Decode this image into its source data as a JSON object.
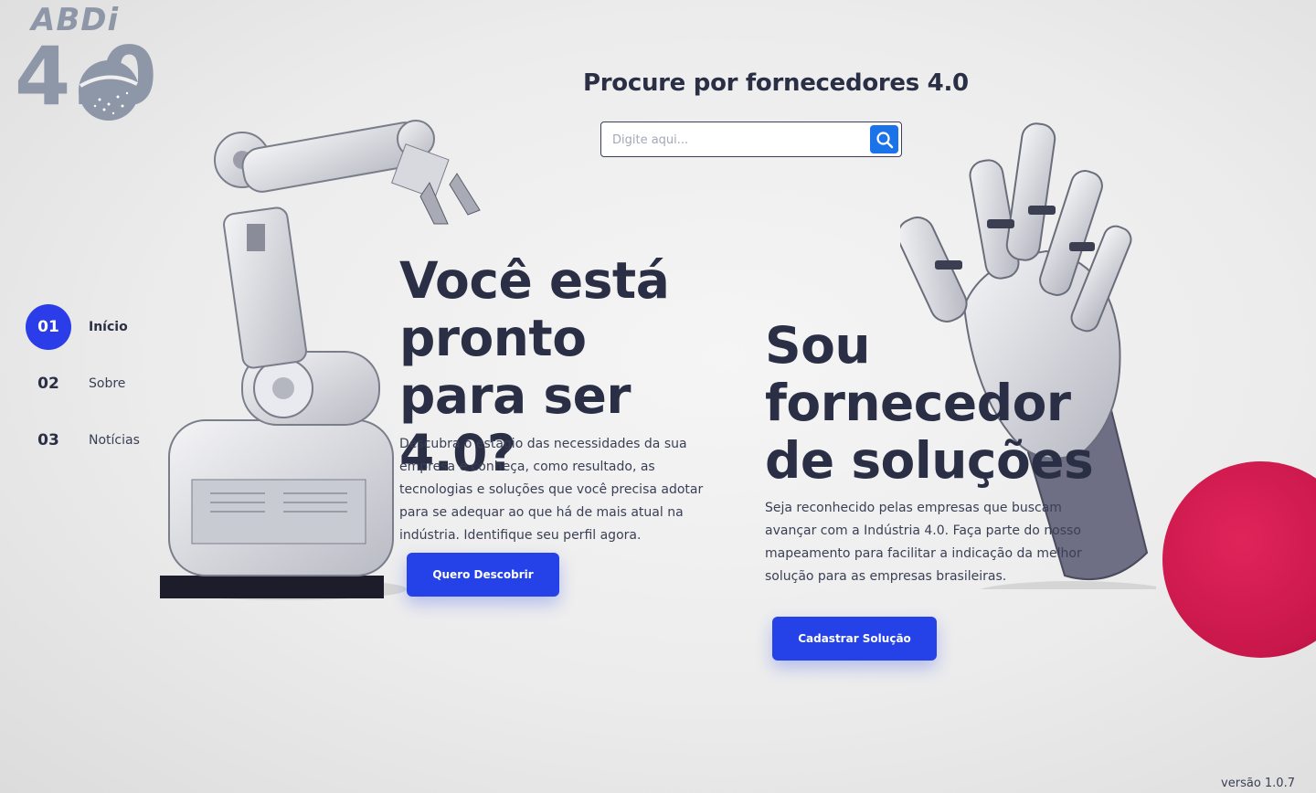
{
  "logo": {
    "brand": "ABDi",
    "sub": "4.0"
  },
  "search": {
    "title": "Procure por fornecedores 4.0",
    "placeholder": "Digite aqui...",
    "value": "",
    "button_icon": "search-icon"
  },
  "nav": {
    "items": [
      {
        "num": "01",
        "label": "Início",
        "active": true
      },
      {
        "num": "02",
        "label": "Sobre",
        "active": false
      },
      {
        "num": "03",
        "label": "Notícias",
        "active": false
      }
    ]
  },
  "hero_left": {
    "title": "Você está pronto para ser 4.0?",
    "description": "Descubra o estágio das necessidades da sua empresa e conheça, como resultado, as tecnologias e soluções que você precisa adotar para se adequar ao que há de mais atual na indústria. Identifique seu perfil agora.",
    "button": "Quero Descobrir"
  },
  "hero_right": {
    "title": "Sou fornecedor de soluções",
    "description": "Seja reconhecido pelas empresas que buscam avançar com a Indústria 4.0. Faça parte do nosso mapeamento para facilitar a indicação da melhor solução para as empresas brasileiras.",
    "button": "Cadastrar Solução"
  },
  "version": "versão 1.0.7",
  "colors": {
    "accent": "#2541e8",
    "search_button": "#1a73e8",
    "text": "#2b2f45",
    "highlight_circle": "#c8174a"
  }
}
